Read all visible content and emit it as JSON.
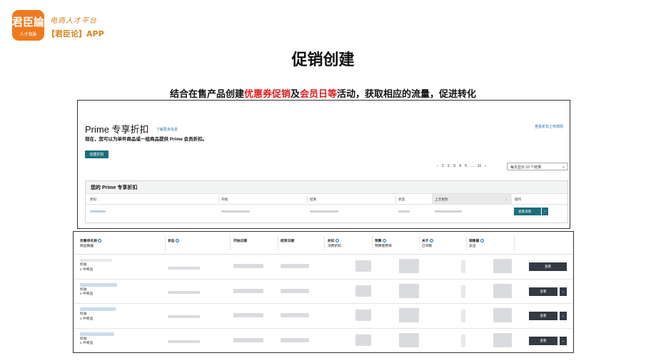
{
  "logo": {
    "glyph": "君臣論",
    "tagline": "人才商脉",
    "slogan": "电商人才平台",
    "app": "【君臣论】APP",
    "brand_color": "#ef7a1e"
  },
  "page": {
    "title": "促销创建",
    "subtitle_parts": [
      "结合在售产品创建",
      "优惠券促销",
      "及",
      "会员日等",
      "活动，获取相应的流量，促进转化"
    ],
    "highlight_color": "#e21a1a"
  },
  "prime_panel": {
    "title": "Prime 专享折扣",
    "learn_more": "了解更多信息",
    "rules_link": "查看折扣上传规则",
    "description": "现在，您可以为单件商品或一组商品提供 Prime 会员折扣。",
    "create_button": "创建折扣",
    "pagination": [
      "‹",
      "1",
      "2",
      "3",
      "4",
      "5",
      "...",
      "11",
      "›"
    ],
    "per_page": "每页显示 10 个结果",
    "section_title": "您的 Prime 专享折扣",
    "columns": [
      "折扣",
      "开始",
      "结束",
      "状态",
      "上次更改",
      "操作"
    ],
    "detail_button": "查看详情",
    "accent_color": "#1c6e7b"
  },
  "coupon_panel": {
    "columns": [
      {
        "title": "优惠券名称",
        "sub": "商品数据"
      },
      {
        "title": "状态",
        "sub": ""
      },
      {
        "title": "开始日期",
        "sub": ""
      },
      {
        "title": "结束日期",
        "sub": ""
      },
      {
        "title": "折扣",
        "sub": "消费折扣"
      },
      {
        "title": "预算",
        "sub": "预算使用率"
      },
      {
        "title": "关于",
        "sub": "已领取"
      },
      {
        "title": "销售额",
        "sub": "支出"
      }
    ],
    "rows": [
      {
        "type": "标准",
        "count": "1 件商品",
        "action": "查看"
      },
      {
        "type": "标准",
        "count": "4 件商品",
        "action": "查看"
      },
      {
        "type": "标准",
        "count": "1 件商品",
        "action": "查看"
      },
      {
        "type": "标准",
        "count": "1 件商品",
        "action": "查看"
      }
    ],
    "button_color": "#333a44"
  }
}
